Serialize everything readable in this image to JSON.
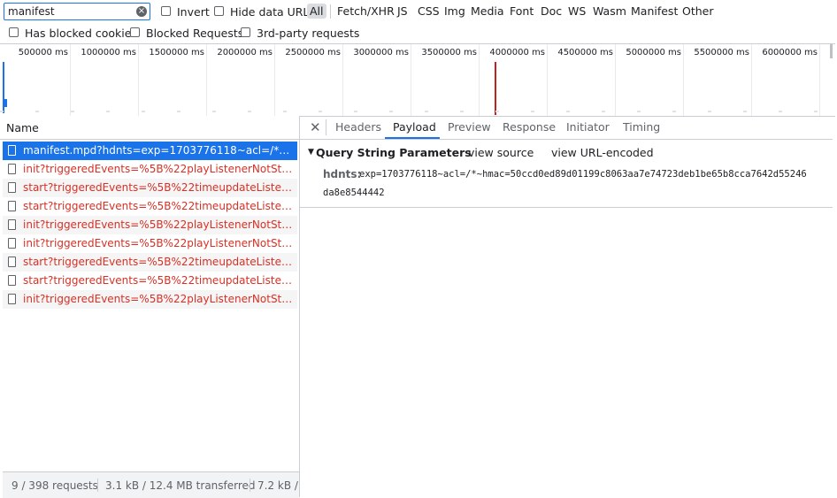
{
  "toolbar": {
    "filter_value": "manifest",
    "invert_label": "Invert",
    "hide_data_urls_label": "Hide data URLs",
    "types": [
      "All",
      "Fetch/XHR",
      "JS",
      "CSS",
      "Img",
      "Media",
      "Font",
      "Doc",
      "WS",
      "Wasm",
      "Manifest",
      "Other"
    ],
    "active_type": "All",
    "has_blocked_cookies_label": "Has blocked cookies",
    "blocked_requests_label": "Blocked Requests",
    "third_party_label": "3rd-party requests"
  },
  "timeline": {
    "ticks": [
      "500000 ms",
      "1000000 ms",
      "1500000 ms",
      "2000000 ms",
      "2500000 ms",
      "3000000 ms",
      "3500000 ms",
      "4000000 ms",
      "4500000 ms",
      "5000000 ms",
      "5500000 ms",
      "6000000 ms"
    ]
  },
  "requests": {
    "column_name": "Name",
    "rows": [
      {
        "name": "manifest.mpd?hdnts=exp=1703776118~acl=/*~hmac=...",
        "selected": true,
        "error": false
      },
      {
        "name": "init?triggeredEvents=%5B%22playListenerNotStarted...",
        "selected": false,
        "error": true
      },
      {
        "name": "start?triggeredEvents=%5B%22timeupdateListener%...",
        "selected": false,
        "error": true
      },
      {
        "name": "start?triggeredEvents=%5B%22timeupdateListener%...",
        "selected": false,
        "error": true
      },
      {
        "name": "init?triggeredEvents=%5B%22playListenerNotStarted...",
        "selected": false,
        "error": true
      },
      {
        "name": "init?triggeredEvents=%5B%22playListenerNotStarted...",
        "selected": false,
        "error": true
      },
      {
        "name": "start?triggeredEvents=%5B%22timeupdateListener%...",
        "selected": false,
        "error": true
      },
      {
        "name": "start?triggeredEvents=%5B%22timeupdateListener%...",
        "selected": false,
        "error": true
      },
      {
        "name": "init?triggeredEvents=%5B%22playListenerNotStarted...",
        "selected": false,
        "error": true
      }
    ]
  },
  "status": {
    "requests": "9 / 398 requests",
    "transferred": "3.1 kB / 12.4 MB transferred",
    "resources": "7.2 kB /"
  },
  "details": {
    "close_glyph": "✕",
    "tabs": [
      "Headers",
      "Payload",
      "Preview",
      "Response",
      "Initiator",
      "Timing"
    ],
    "active_tab": "Payload",
    "section_title": "Query String Parameters",
    "view_source": "view source",
    "view_url_encoded": "view URL-encoded",
    "param_key": "hdnts:",
    "param_value_line1": "exp=1703776118~acl=/*~hmac=50ccd0ed89d01199c8063aa7e74723deb1be65b8cca7642d55246",
    "param_value_line2": "da8e8544442"
  },
  "colors": {
    "accent": "#1a73e8",
    "error": "#d93025",
    "timeline_marker": "#c5221f"
  }
}
